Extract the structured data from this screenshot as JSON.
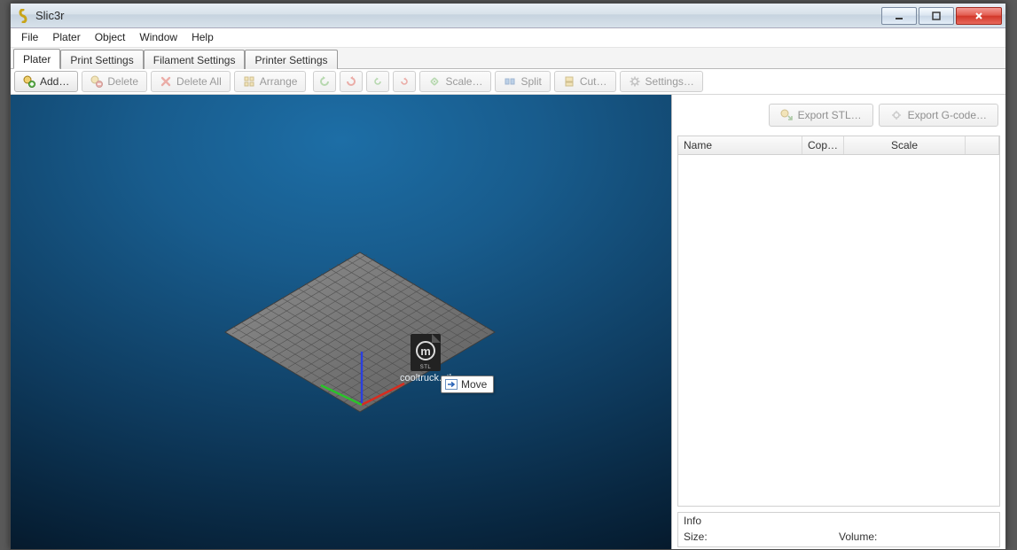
{
  "title": "Slic3r",
  "menus": {
    "file": "File",
    "plater": "Plater",
    "object": "Object",
    "window": "Window",
    "help": "Help"
  },
  "tabs": {
    "plater": "Plater",
    "print": "Print Settings",
    "filament": "Filament Settings",
    "printer": "Printer Settings"
  },
  "toolbar": {
    "add": "Add…",
    "delete": "Delete",
    "delete_all": "Delete All",
    "arrange": "Arrange",
    "scale": "Scale…",
    "split": "Split",
    "cut": "Cut…",
    "settings": "Settings…"
  },
  "icons": {
    "add": "add-icon",
    "delete": "delete-icon",
    "delete_all": "x-icon",
    "arrange": "arrange-icon",
    "rot_ccw_lg": "rotate-ccw-big-icon",
    "rot_cw_lg": "rotate-cw-big-icon",
    "rot_ccw_sm": "rotate-ccw-small-icon",
    "rot_cw_sm": "rotate-cw-small-icon",
    "scale": "scale-icon",
    "split": "split-icon",
    "cut": "cut-icon",
    "settings": "gear-icon",
    "export_stl": "export-stl-icon",
    "export_gcode": "export-gcode-icon"
  },
  "export": {
    "stl": "Export STL…",
    "gcode": "Export G-code…"
  },
  "columns": {
    "name": "Name",
    "copies": "Cop…",
    "scale": "Scale"
  },
  "info": {
    "header": "Info",
    "size": "Size:",
    "volume": "Volume:"
  },
  "drag": {
    "filename": "cooltruck.stl",
    "doc_badge": "STL",
    "tooltip": "Move"
  }
}
